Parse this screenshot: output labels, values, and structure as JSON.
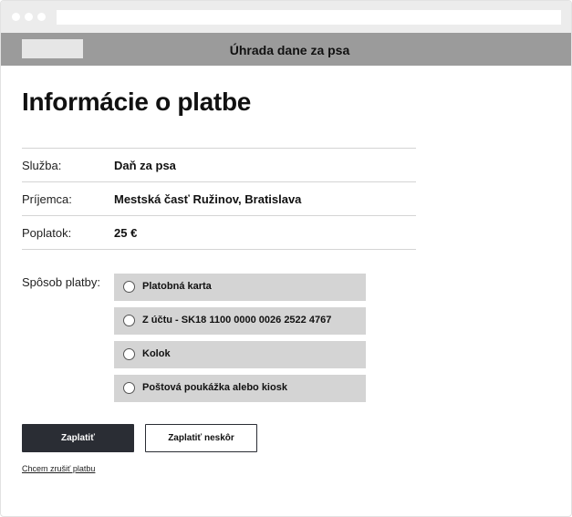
{
  "header": {
    "title": "Úhrada dane za psa"
  },
  "main": {
    "title": "Informácie o platbe",
    "info_rows": [
      {
        "label": "Služba:",
        "value": "Daň za psa"
      },
      {
        "label": "Príjemca:",
        "value": "Mestská časť Ružinov, Bratislava"
      },
      {
        "label": "Poplatok:",
        "value": "25 €"
      }
    ],
    "payment": {
      "label": "Spôsob platby:",
      "options": [
        "Platobná karta",
        "Z účtu - SK18 1100 0000 0026 2522 4767",
        "Kolok",
        "Poštová poukážka alebo kiosk"
      ]
    },
    "actions": {
      "pay_label": "Zaplatiť",
      "pay_later_label": "Zaplatiť neskôr",
      "cancel_label": "Chcem zrušiť platbu"
    }
  },
  "colors": {
    "header_bg": "#9b9b9b",
    "option_bg": "#d4d4d4",
    "primary_button": "#2a2d34"
  }
}
